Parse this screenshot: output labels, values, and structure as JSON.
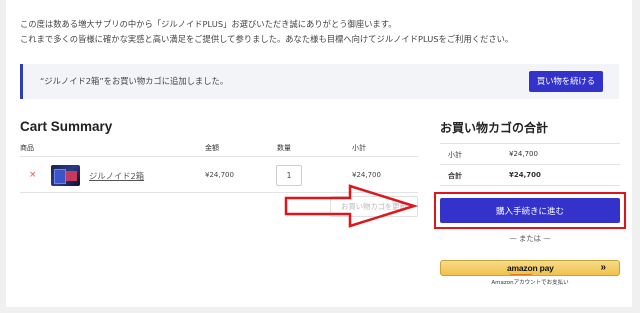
{
  "intro": {
    "line1": "この度は数ある増大サプリの中から「ジルノイドPLUS」お選びいただき誠にありがとう御座います。",
    "line2": "これまで多くの皆様に確かな実感と高い満足をご提供して参りました。あなた様も目標へ向けてジルノイドPLUSをご利用ください。"
  },
  "notice": {
    "message": "“ジルノイド2箱”をお買い物カゴに追加しました。",
    "continue_label": "買い物を続ける"
  },
  "cart": {
    "title": "Cart Summary",
    "headers": [
      "商品",
      "金額",
      "数量",
      "小計"
    ],
    "item": {
      "remove": "×",
      "name": "ジルノイド2箱",
      "price": "¥24,700",
      "quantity": "1",
      "subtotal": "¥24,700"
    },
    "update_label": "お買い物カゴを更新"
  },
  "totals": {
    "title": "お買い物カゴの合計",
    "subtotal_label": "小計",
    "subtotal_value": "¥24,700",
    "total_label": "合計",
    "total_value": "¥24,700",
    "checkout_label": "購入手続きに進む",
    "or_label": "— または —",
    "amazon_logo": "amazon pay",
    "amazon_chevron": "»",
    "amazon_sub": "Amazonアカウントでお支払い"
  },
  "colors": {
    "accent": "#3333cc",
    "highlight": "#e0141b",
    "amazon": "#f0c14b"
  }
}
